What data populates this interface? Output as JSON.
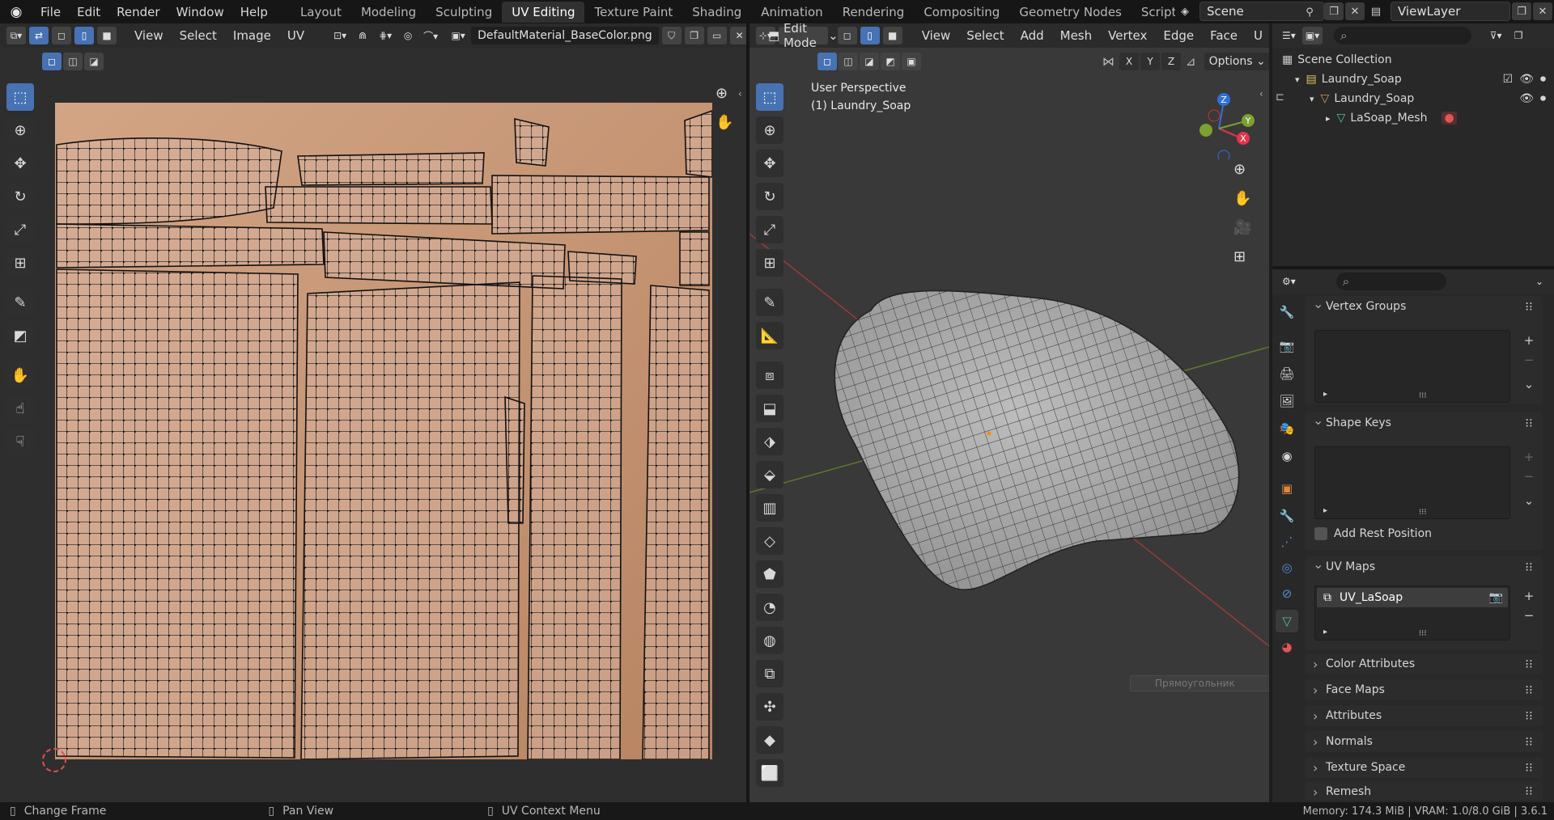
{
  "app": {
    "logo": "blender-logo",
    "menus": [
      "File",
      "Edit",
      "Render",
      "Window",
      "Help"
    ],
    "workspaces": [
      "Layout",
      "Modeling",
      "Sculpting",
      "UV Editing",
      "Texture Paint",
      "Shading",
      "Animation",
      "Rendering",
      "Compositing",
      "Geometry Nodes",
      "Scripting"
    ],
    "active_workspace": "UV Editing",
    "add_workspace": "+",
    "scene": "Scene",
    "view_layer": "ViewLayer"
  },
  "uv_editor": {
    "menus": [
      "View",
      "Select",
      "Image",
      "UV"
    ],
    "image_name": "DefaultMaterial_BaseColor.png"
  },
  "viewport": {
    "mode": "Edit Mode",
    "menus": [
      "View",
      "Select",
      "Add",
      "Mesh",
      "Vertex",
      "Edge",
      "Face",
      "U"
    ],
    "axes": [
      "X",
      "Y",
      "Z"
    ],
    "options": "Options",
    "perspective": "User Perspective",
    "object_label": "(1) Laundry_Soap",
    "gizmo": {
      "x": "X",
      "y": "Y",
      "z": "Z"
    },
    "tooltip": "Прямоугольник"
  },
  "outliner": {
    "root": "Scene Collection",
    "items": [
      {
        "label": "Laundry_Soap",
        "level": 0
      },
      {
        "label": "Laundry_Soap",
        "level": 1
      },
      {
        "label": "LaSoap_Mesh",
        "level": 2
      }
    ]
  },
  "properties": {
    "vertex_groups": "Vertex Groups",
    "shape_keys": "Shape Keys",
    "add_rest_position": "Add Rest Position",
    "uv_maps": "UV Maps",
    "uv_map_item": "UV_LaSoap",
    "collapsed": [
      "Color Attributes",
      "Face Maps",
      "Attributes",
      "Normals",
      "Texture Space",
      "Remesh"
    ]
  },
  "status": {
    "left": "Change Frame",
    "mid": "Pan View",
    "right": "UV Context Menu",
    "stats": "Memory: 174.3 MiB | VRAM: 1.0/8.0 GiB | 3.6.1"
  },
  "colors": {
    "accent": "#4772b3",
    "axis_x": "#e2374b",
    "axis_y": "#7ca12e",
    "axis_z": "#2f6fd8",
    "texture": "#c89a76"
  }
}
